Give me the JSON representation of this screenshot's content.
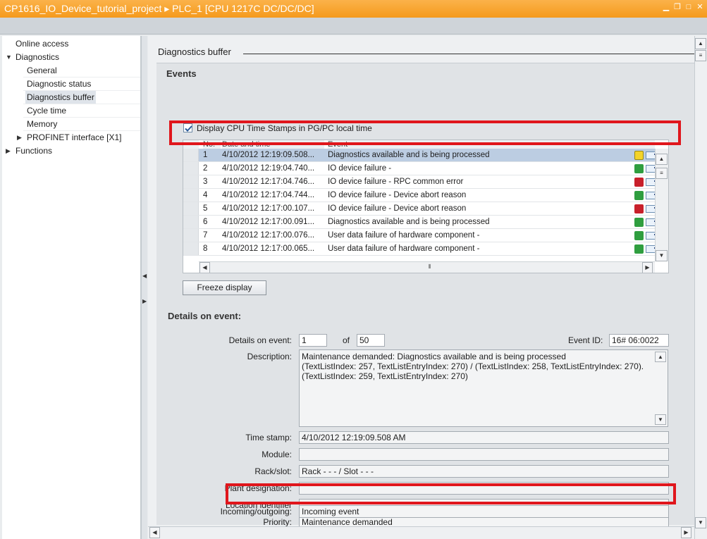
{
  "window": {
    "title": "CP1616_IO_Device_tutorial_project  ▸  PLC_1 [CPU 1217C DC/DC/DC]"
  },
  "nav": {
    "items": [
      {
        "label": "Online access",
        "level": 0,
        "arrow": ""
      },
      {
        "label": "Diagnostics",
        "level": 0,
        "arrow": "▼"
      },
      {
        "label": "General",
        "level": 1,
        "arrow": ""
      },
      {
        "label": "Diagnostic status",
        "level": 1,
        "arrow": ""
      },
      {
        "label": "Diagnostics buffer",
        "level": 1,
        "arrow": "",
        "selected": true
      },
      {
        "label": "Cycle time",
        "level": 1,
        "arrow": ""
      },
      {
        "label": "Memory",
        "level": 1,
        "arrow": ""
      },
      {
        "label": "PROFINET interface [X1]",
        "level": 1,
        "arrow": "▶"
      },
      {
        "label": "Functions",
        "level": 0,
        "arrow": "▶"
      }
    ]
  },
  "main": {
    "header_title": "Diagnostics buffer",
    "events_title": "Events",
    "checkbox_label": "Display CPU Time Stamps in PG/PC local time",
    "checkbox_checked": true,
    "table": {
      "columns": [
        "No.",
        "Date and time",
        "Event"
      ],
      "rows": [
        {
          "no": "1",
          "time": "4/10/2012 12:19:09.508...",
          "event": "Diagnostics available and is being processed",
          "status": "maint",
          "selected": true
        },
        {
          "no": "2",
          "time": "4/10/2012 12:19:04.740...",
          "event": "IO device failure -",
          "status": "ok"
        },
        {
          "no": "3",
          "time": "4/10/2012 12:17:04.746...",
          "event": "IO device failure - RPC common error",
          "status": "err"
        },
        {
          "no": "4",
          "time": "4/10/2012 12:17:04.744...",
          "event": "IO device failure - Device abort reason",
          "status": "ok"
        },
        {
          "no": "5",
          "time": "4/10/2012 12:17:00.107...",
          "event": "IO device failure - Device abort reason",
          "status": "err"
        },
        {
          "no": "6",
          "time": "4/10/2012 12:17:00.091...",
          "event": "Diagnostics available and is being processed",
          "status": "ok"
        },
        {
          "no": "7",
          "time": "4/10/2012 12:17:00.076...",
          "event": "User data failure of hardware component -",
          "status": "ok"
        },
        {
          "no": "8",
          "time": "4/10/2012 12:17:00.065...",
          "event": "User data failure of hardware component -",
          "status": "ok"
        }
      ]
    },
    "freeze_button": "Freeze display",
    "details": {
      "title": "Details on event:",
      "details_label": "Details on event:",
      "event_index": "1",
      "of_label": "of",
      "event_total": "50",
      "event_id_label": "Event ID:",
      "event_id": "16# 06:0022",
      "description_label": "Description:",
      "description": "Maintenance demanded: Diagnostics available and is being processed\n (TextListIndex: 257, TextListEntryIndex: 270) / (TextListIndex: 258, TextListEntryIndex: 270).\n(TextListIndex: 259, TextListEntryIndex: 270)",
      "timestamp_label": "Time stamp:",
      "timestamp": "4/10/2012 12:19:09.508 AM",
      "module_label": "Module:",
      "module": "",
      "rack_label": "Rack/slot:",
      "rack": "Rack - - - / Slot - - -",
      "plant_label": "Plant designation:",
      "plant": "",
      "location_label": "Location identifier",
      "location": "",
      "priority_label": "Priority:",
      "priority": "Maintenance demanded",
      "incoming_label": "Incoming/outgoing:",
      "incoming": "Incoming event"
    }
  },
  "colors": {
    "title_bar": "#f59a1c",
    "highlight": "#e0161c",
    "selected_row": "#bccde2"
  }
}
